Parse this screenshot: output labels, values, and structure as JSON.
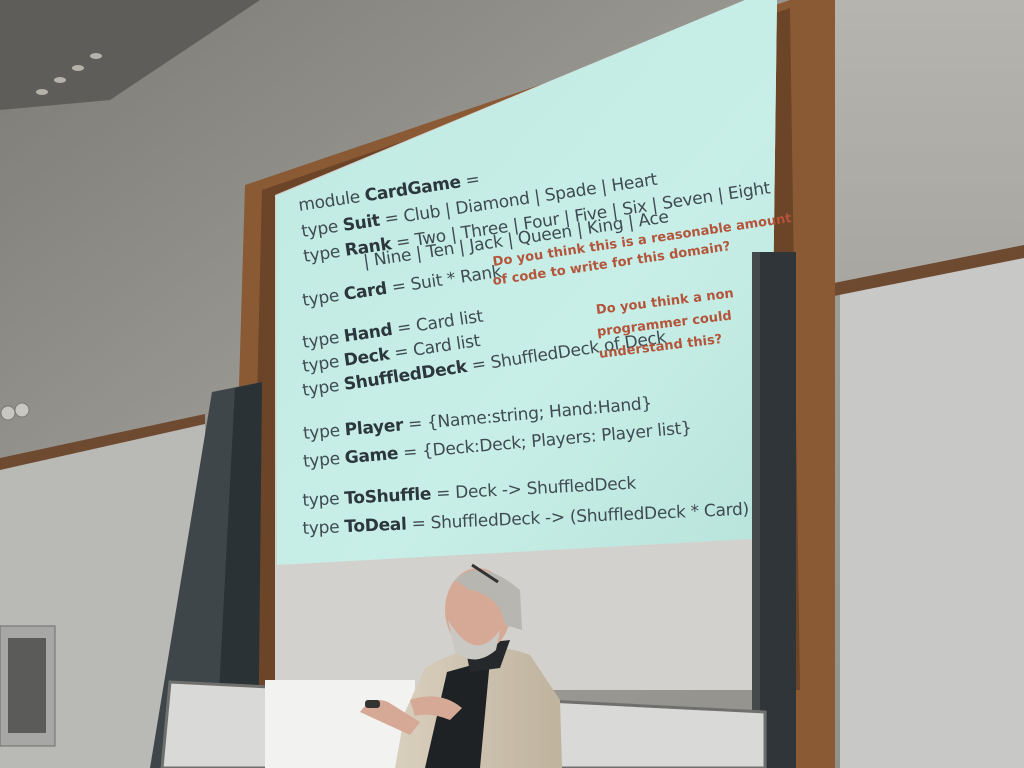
{
  "slide": {
    "code_lines": [
      {
        "kw1": "module",
        "name": "CardGame",
        "rest": " ="
      },
      {
        "kw1": "type",
        "name": "Suit",
        "rest": " = Club | Diamond | Spade | Heart"
      },
      {
        "kw1": "type",
        "name": "Rank",
        "rest": " = Two | Three | Four | Five | Six | Seven | Eight"
      },
      {
        "kw1": "",
        "name": "",
        "rest": "| Nine | Ten | Jack | Queen | King | Ace"
      },
      {
        "kw1": "type",
        "name": "Card",
        "rest": " = Suit * Rank"
      },
      {
        "kw1": "type",
        "name": "Hand",
        "rest": " = Card list"
      },
      {
        "kw1": "type",
        "name": "Deck",
        "rest": " = Card list"
      },
      {
        "kw1": "type",
        "name": "ShuffledDeck",
        "rest": " = ShuffledDeck of Deck"
      },
      {
        "kw1": "type",
        "name": "Player",
        "rest": " = {Name:string; Hand:Hand}"
      },
      {
        "kw1": "type",
        "name": "Game",
        "rest": " = {Deck:Deck; Players: Player list}"
      },
      {
        "kw1": "type",
        "name": "ToShuffle",
        "rest": " = Deck -> ShuffledDeck"
      },
      {
        "kw1": "type",
        "name": "ToDeal",
        "rest": " = ShuffledDeck -> (ShuffledDeck * Card)"
      }
    ],
    "note_1": [
      "Do you think this is a reasonable amount",
      "of code to write for this domain?"
    ],
    "note_2": [
      "Do you think a non",
      "programmer could",
      "understand this?"
    ]
  },
  "colors": {
    "wall": "#9a9893",
    "screen": "#c4ede5",
    "wood_frame": "#8a5a35",
    "code_text": "#3f4a52",
    "note_text": "#b4543b"
  }
}
